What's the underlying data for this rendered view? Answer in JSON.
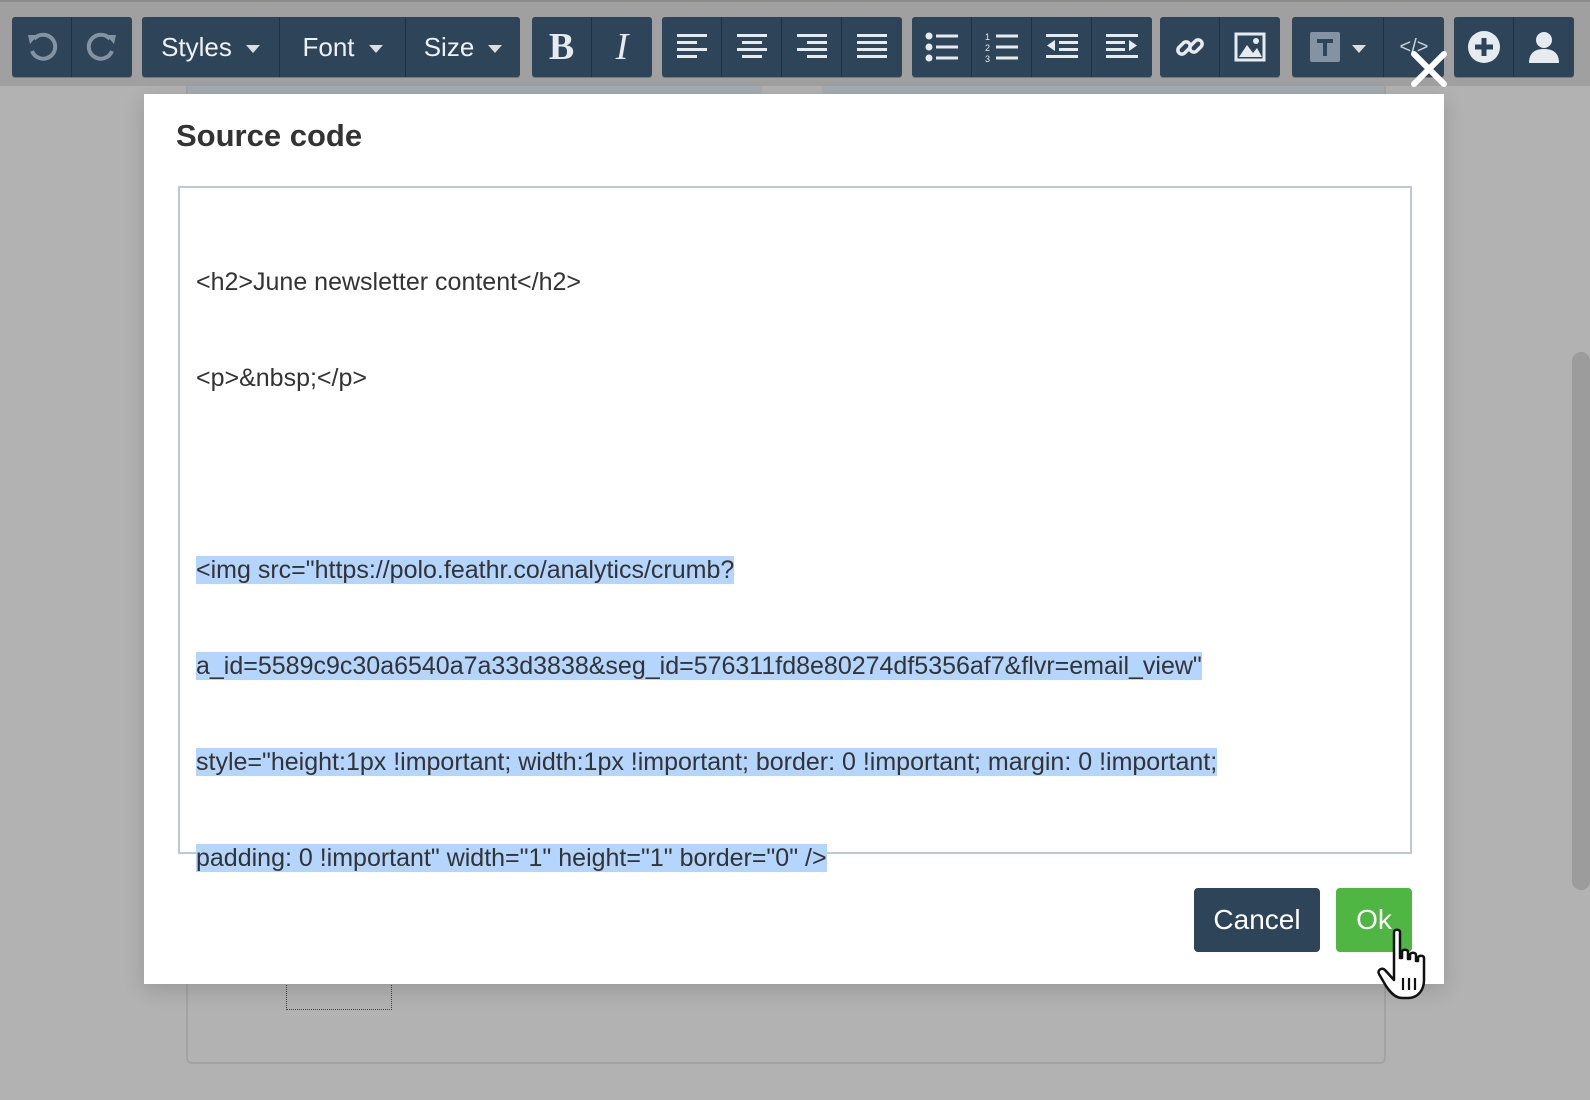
{
  "toolbar": {
    "undo_icon": "undo-icon",
    "redo_icon": "redo-icon",
    "styles_label": "Styles",
    "font_label": "Font",
    "size_label": "Size",
    "bold_label": "B",
    "italic_label": "I",
    "icons": [
      "align-left-icon",
      "align-center-icon",
      "align-right-icon",
      "align-justify-icon",
      "bullet-list-icon",
      "numbered-list-icon",
      "outdent-icon",
      "indent-icon",
      "link-icon",
      "image-icon",
      "text-block-icon",
      "source-code-icon",
      "add-icon",
      "user-icon"
    ],
    "source_label": "</>"
  },
  "colors": {
    "toolbar_button": "#2d4459",
    "ok_button": "#4fb543",
    "selection": "#b4d5fe"
  },
  "modal": {
    "title": "Source code",
    "code_lines": [
      "<h2>June newsletter content</h2>",
      "<p>&nbsp;</p>",
      "",
      "<img src=\"https://polo.feathr.co/analytics/crumb?",
      "a_id=5589c9c30a6540a7a33d3838&seg_id=576311fd8e80274df5356af7&flvr=email_view\"",
      "style=\"height:1px !important; width:1px !important; border: 0 !important; margin: 0 !important;",
      "padding: 0 !important\" width=\"1\" height=\"1\" border=\"0\" />"
    ],
    "cancel_label": "Cancel",
    "ok_label": "Ok"
  }
}
